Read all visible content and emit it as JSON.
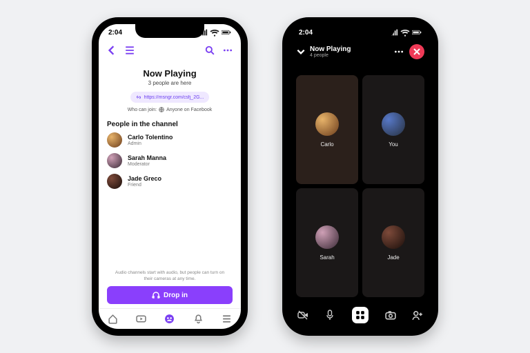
{
  "left": {
    "time": "2:04",
    "title": "Now Playing",
    "subtitle": "3 people are here",
    "share_link": "https://msngr.com/csfj_2G...",
    "who_can_join_label": "Who can join:",
    "who_can_join_value": "Anyone on Facebook",
    "section_header": "People in the channel",
    "people": [
      {
        "name": "Carlo Tolentino",
        "role": "Admin"
      },
      {
        "name": "Sarah Manna",
        "role": "Moderator"
      },
      {
        "name": "Jade Greco",
        "role": "Friend"
      }
    ],
    "footer_note": "Audio channels start with audio, but people can turn on their cameras at any time.",
    "cta": "Drop in"
  },
  "right": {
    "time": "2:04",
    "title": "Now Playing",
    "subtitle": "4 people",
    "tiles": [
      {
        "label": "Carlo"
      },
      {
        "label": "You"
      },
      {
        "label": "Sarah"
      },
      {
        "label": "Jade"
      }
    ]
  }
}
